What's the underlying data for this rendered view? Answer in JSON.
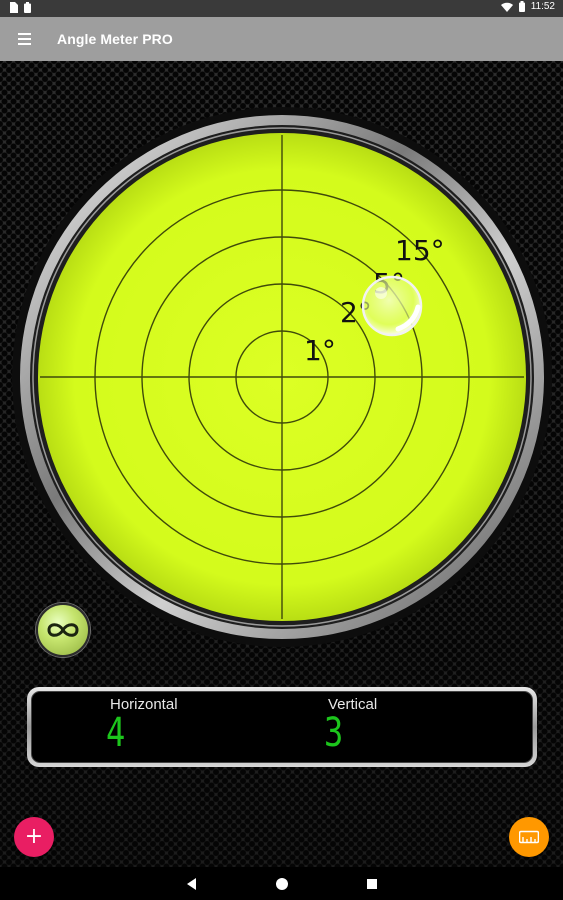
{
  "status_bar": {
    "time": "11:52",
    "left_icons": [
      "sim-card-icon",
      "battery-saver-icon"
    ],
    "right_icons": [
      "wifi-icon",
      "battery-icon"
    ]
  },
  "app_bar": {
    "title": "Angle Meter PRO",
    "menu_icon": "hamburger-menu-icon"
  },
  "bubble_level": {
    "face_color": "#d7ff1e",
    "ring_labels": [
      "1°",
      "2°",
      "5°",
      "15°"
    ],
    "bubble_position": {
      "tilt_x_deg": 4,
      "tilt_y_deg": 3
    }
  },
  "lock_button": {
    "icon": "infinity-icon"
  },
  "readout": {
    "horizontal_label": "Horizontal",
    "horizontal_value": "4",
    "vertical_label": "Vertical",
    "vertical_value": "3",
    "digit_color": "#1cc51c"
  },
  "fab_add": {
    "icon": "plus-icon",
    "color": "#e91e63",
    "glyph": "+"
  },
  "fab_ruler": {
    "icon": "ruler-icon",
    "color": "#ff9800"
  },
  "nav_bar": {
    "icons": [
      "back-icon",
      "home-icon",
      "recents-icon"
    ]
  }
}
